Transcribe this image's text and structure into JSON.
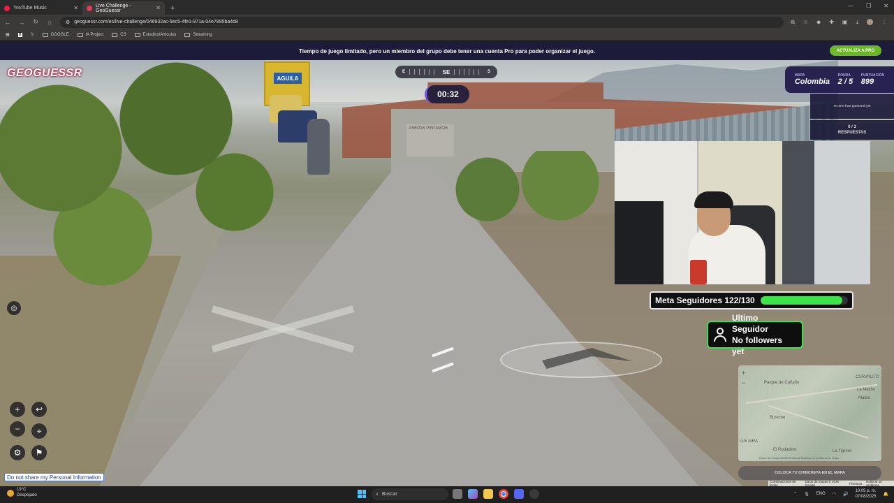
{
  "browser": {
    "tabs": [
      {
        "label": "YouTube Music",
        "color": "#ff1744",
        "active": false
      },
      {
        "label": "Live Challenge - GeoGuessr",
        "color": "#e23a5c",
        "active": true
      }
    ],
    "new_tab": "+",
    "url": "geoguessr.com/es/live-challenge/046932ac-5ec5-4fe1-971a-04e7895ba4d8",
    "bookmarks": [
      "GOOGLE",
      "IA Project",
      "CS",
      "Estudios/Articulos",
      "Streaming"
    ]
  },
  "banner": {
    "text": "Tiempo de juego limitado, pero un miembro del grupo debe tener una cuenta Pro para poder organizar el juego.",
    "button": "ACTUALIZA A PRO"
  },
  "scene": {
    "truck_label": "AGUILA",
    "graffiti": "ASEPAS PINTAMOS"
  },
  "game": {
    "logo": "GEOGUESSR",
    "compass": {
      "left": "E",
      "center": "SE",
      "right": "S"
    },
    "timer": "00:32",
    "map_label": "MAPA",
    "map_value": "Colombia",
    "round_label": "RONDA",
    "round_value": "2 / 5",
    "score_label": "PUNTUACIÓN",
    "score_value": "899",
    "guessed_text": "no one has guessed yet",
    "answers_count": "0 / 3",
    "answers_label": "RESPUESTAS",
    "guess_button": "COLOCA TU CHINCHETA EN EL MAPA",
    "privacy": "Do not share my Personal Information"
  },
  "minimap": {
    "labels": [
      "Parque de Cañaño",
      "CURVALITO",
      "La Macho",
      "Mateo",
      "Bureche",
      "El Rodadero",
      "La Tigrera",
      "LLE AIRA"
    ],
    "footer": "Datos del mapa ©2025 Términos Notificar un problema de Maps"
  },
  "attribution": [
    "Combinaciones de teclas",
    "Datos de mapas © 2025 Google",
    "Términos",
    "Notificar un problema"
  ],
  "stream": {
    "goal_text": "Meta Seguidores 122/130",
    "goal_current": 122,
    "goal_target": 130,
    "goal_color": "#3ee34a",
    "follower_title": "Ultimo Seguidor",
    "follower_value": "No followers yet"
  },
  "taskbar": {
    "weather_temp": "19°C",
    "weather_desc": "Despejado",
    "search_placeholder": "Buscar",
    "lang": "ENG",
    "time": "10:05 p. m.",
    "date": "07/08/2025"
  }
}
